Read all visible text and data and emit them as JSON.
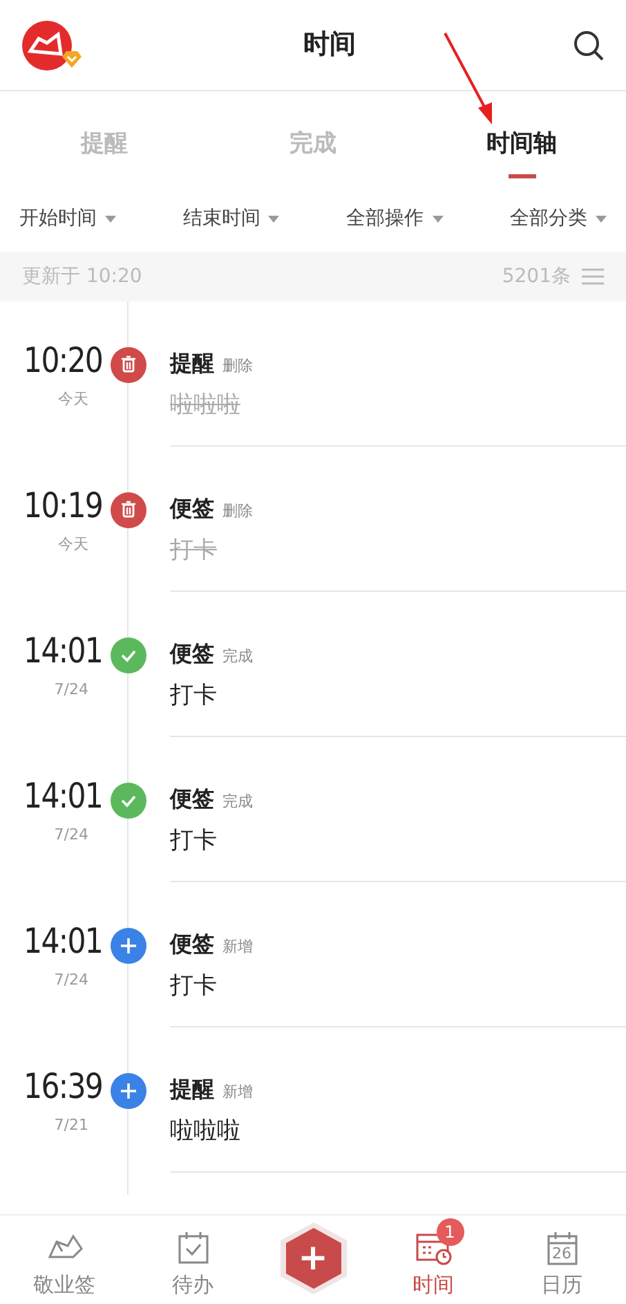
{
  "header": {
    "title": "时间"
  },
  "tabs": [
    {
      "label": "提醒",
      "selected": false
    },
    {
      "label": "完成",
      "selected": false
    },
    {
      "label": "时间轴",
      "selected": true
    }
  ],
  "filters": [
    "开始时间",
    "结束时间",
    "全部操作",
    "全部分类"
  ],
  "update_bar": {
    "text": "更新于 10:20",
    "count": "5201条"
  },
  "entries": [
    {
      "time": "10:20",
      "date": "今天",
      "kind": "delete",
      "category": "提醒",
      "action": "删除",
      "content": "啦啦啦"
    },
    {
      "time": "10:19",
      "date": "今天",
      "kind": "delete",
      "category": "便签",
      "action": "删除",
      "content": "打卡"
    },
    {
      "time": "14:01",
      "date": "7/24",
      "kind": "done",
      "category": "便签",
      "action": "完成",
      "content": "打卡"
    },
    {
      "time": "14:01",
      "date": "7/24",
      "kind": "done",
      "category": "便签",
      "action": "完成",
      "content": "打卡"
    },
    {
      "time": "14:01",
      "date": "7/24",
      "kind": "add",
      "category": "便签",
      "action": "新增",
      "content": "打卡"
    },
    {
      "time": "16:39",
      "date": "7/21",
      "kind": "add",
      "category": "提醒",
      "action": "新增",
      "content": "啦啦啦"
    }
  ],
  "bottom_nav": [
    {
      "kind": "notes",
      "label": "敬业签",
      "selected": false
    },
    {
      "kind": "todo",
      "label": "待办",
      "selected": false
    },
    {
      "kind": "add",
      "symbol": "+",
      "selected": false
    },
    {
      "kind": "time",
      "label": "时间",
      "selected": true,
      "badge": "1"
    },
    {
      "kind": "calendar",
      "label": "日历",
      "selected": false,
      "icon_text": "26"
    }
  ]
}
